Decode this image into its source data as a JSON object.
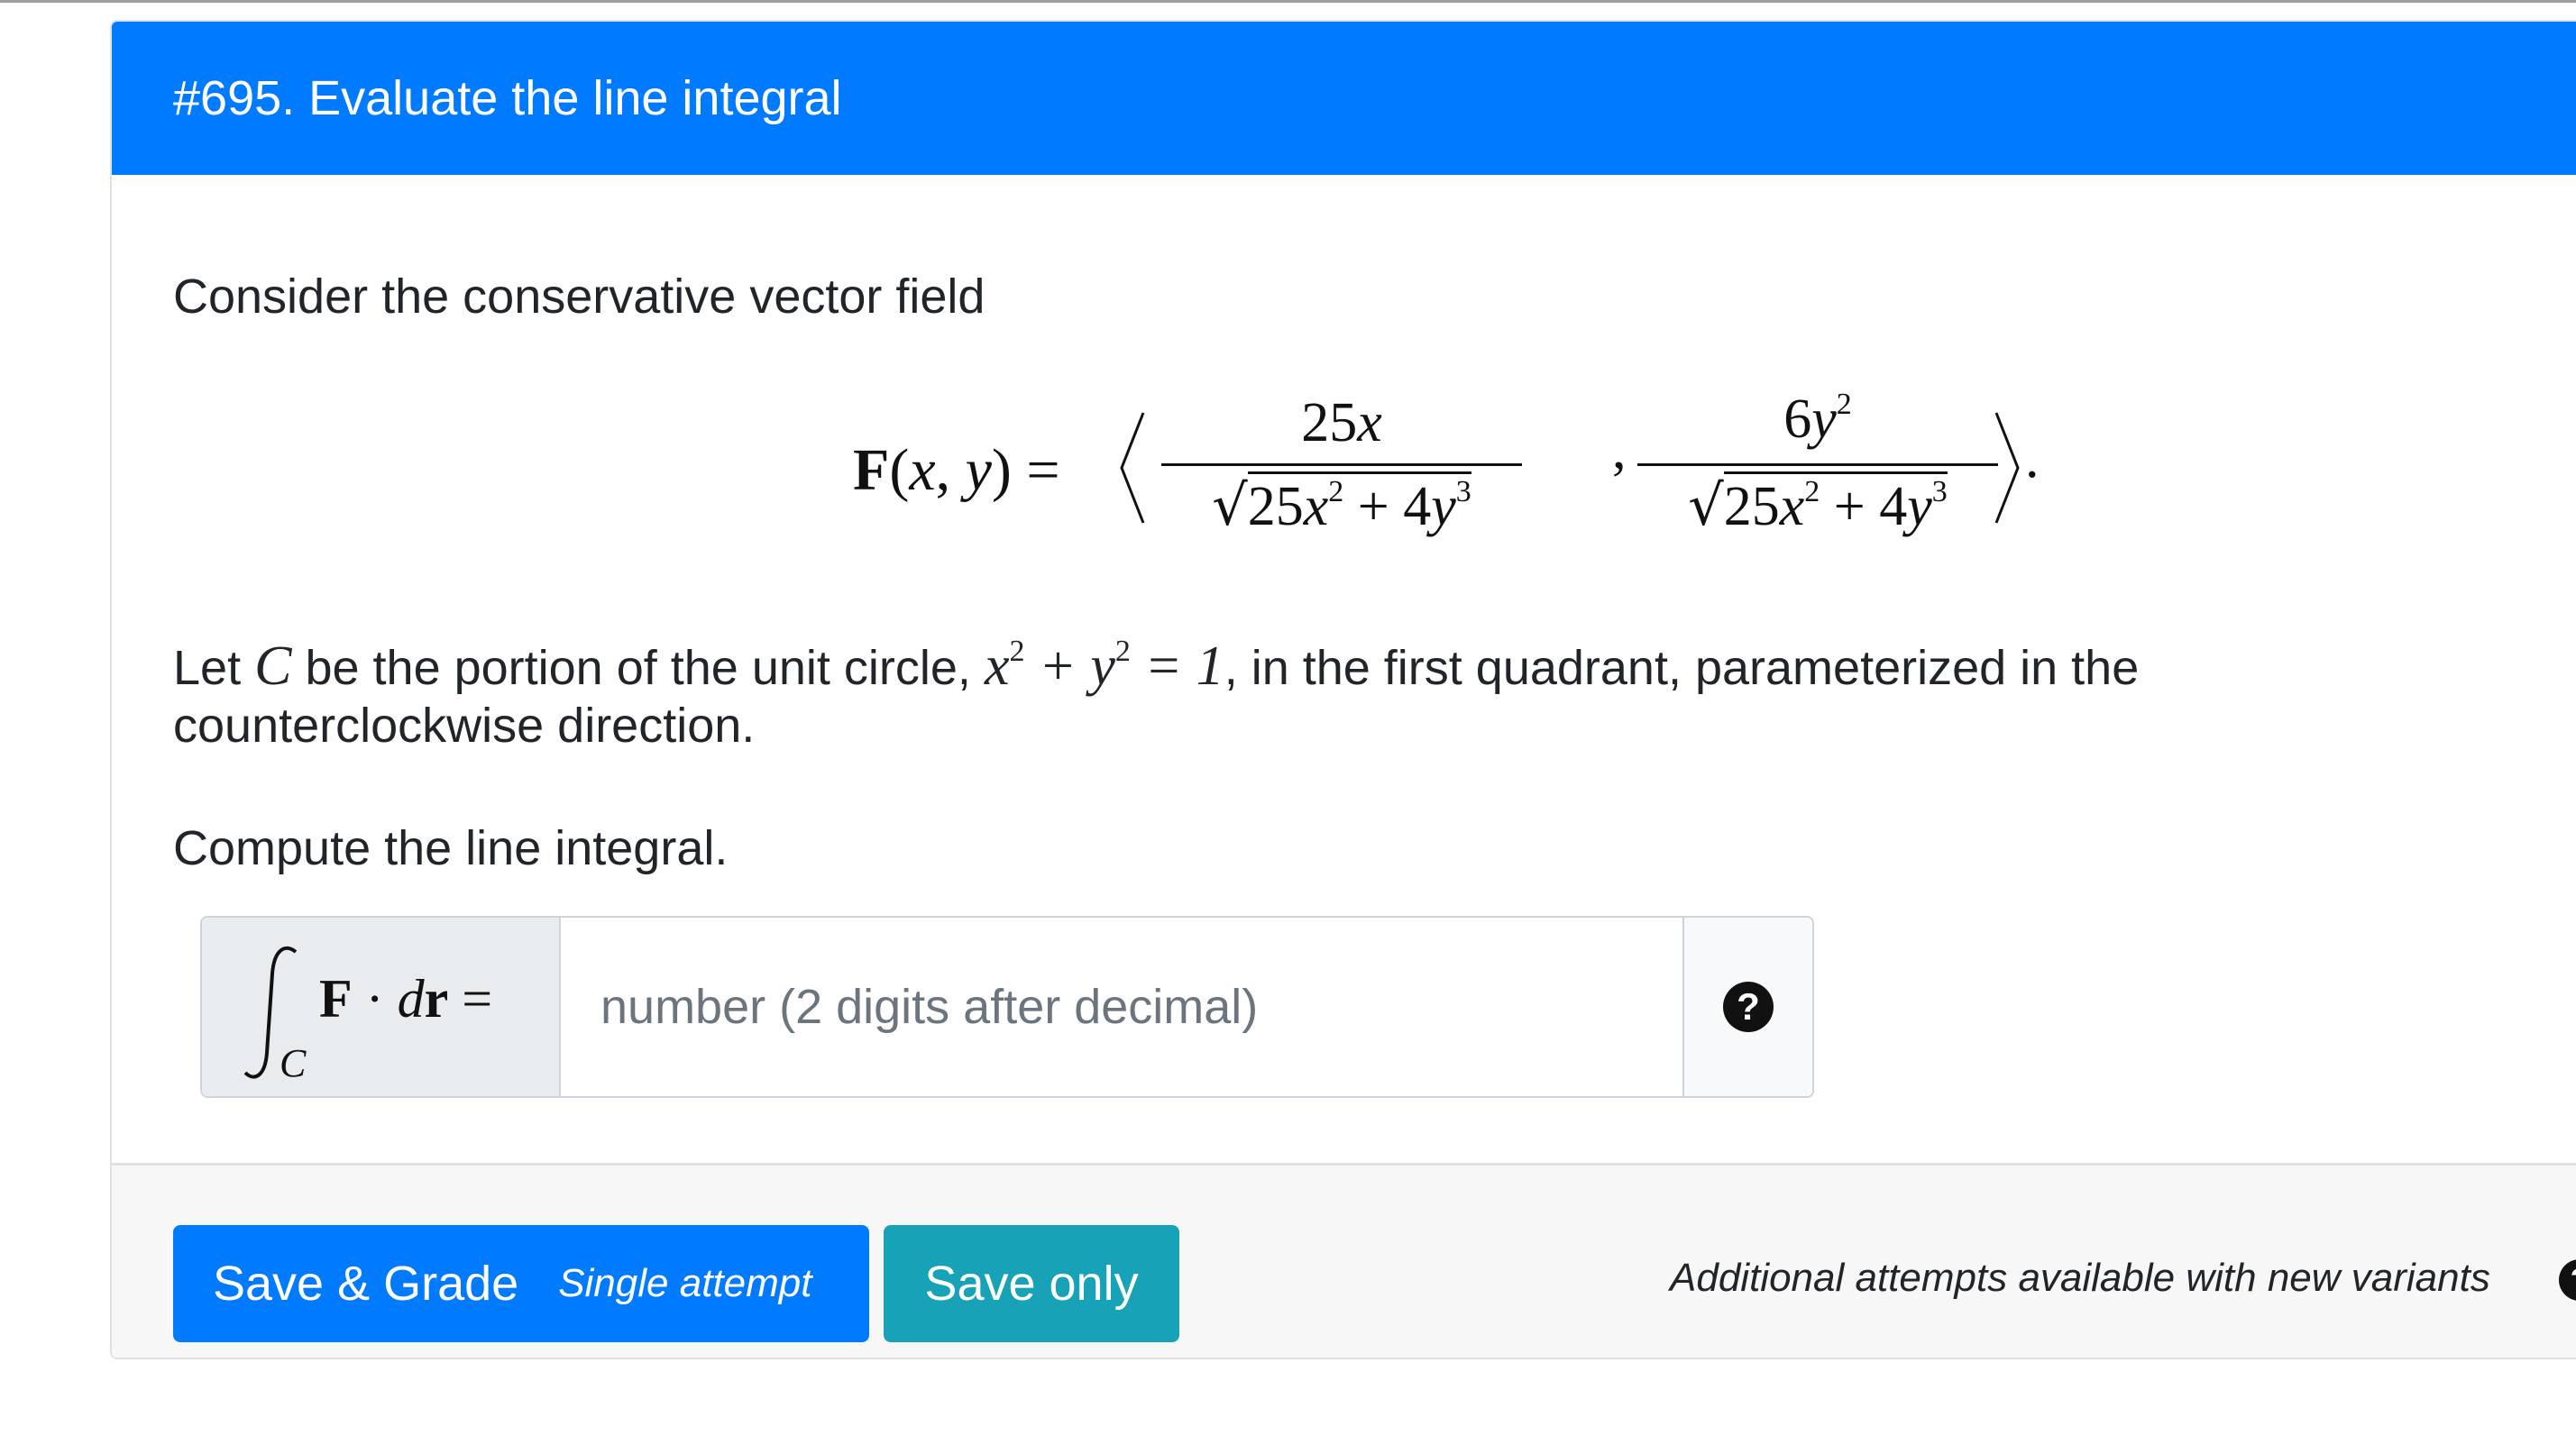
{
  "question": {
    "title": "#695. Evaluate the line integral",
    "intro": "Consider the conservative vector field",
    "field": {
      "lhs": "F(x, y) =",
      "comp1_num": "25x",
      "comp2_num": "6y²",
      "den": "25x² + 4y³"
    },
    "let_prefix": "Let",
    "let_var": "C",
    "let_mid": "be the portion of the unit circle,",
    "let_eq": "x² + y² = 1",
    "let_suffix": ", in the first quadrant, parameterized in the",
    "let_line2": "counterclockwise direction.",
    "compute": "Compute the line integral."
  },
  "answer": {
    "prepend_label": "∫C F · dr =",
    "placeholder": "number (2 digits after decimal)",
    "help_icon": "question-circle-icon"
  },
  "footer": {
    "grade_label": "Save & Grade",
    "grade_sub": "Single attempt",
    "save_label": "Save only",
    "note": "Additional attempts available with new variants"
  },
  "colors": {
    "header": "#007bff",
    "grade_button": "#007bff",
    "save_button": "#17a2b8"
  }
}
